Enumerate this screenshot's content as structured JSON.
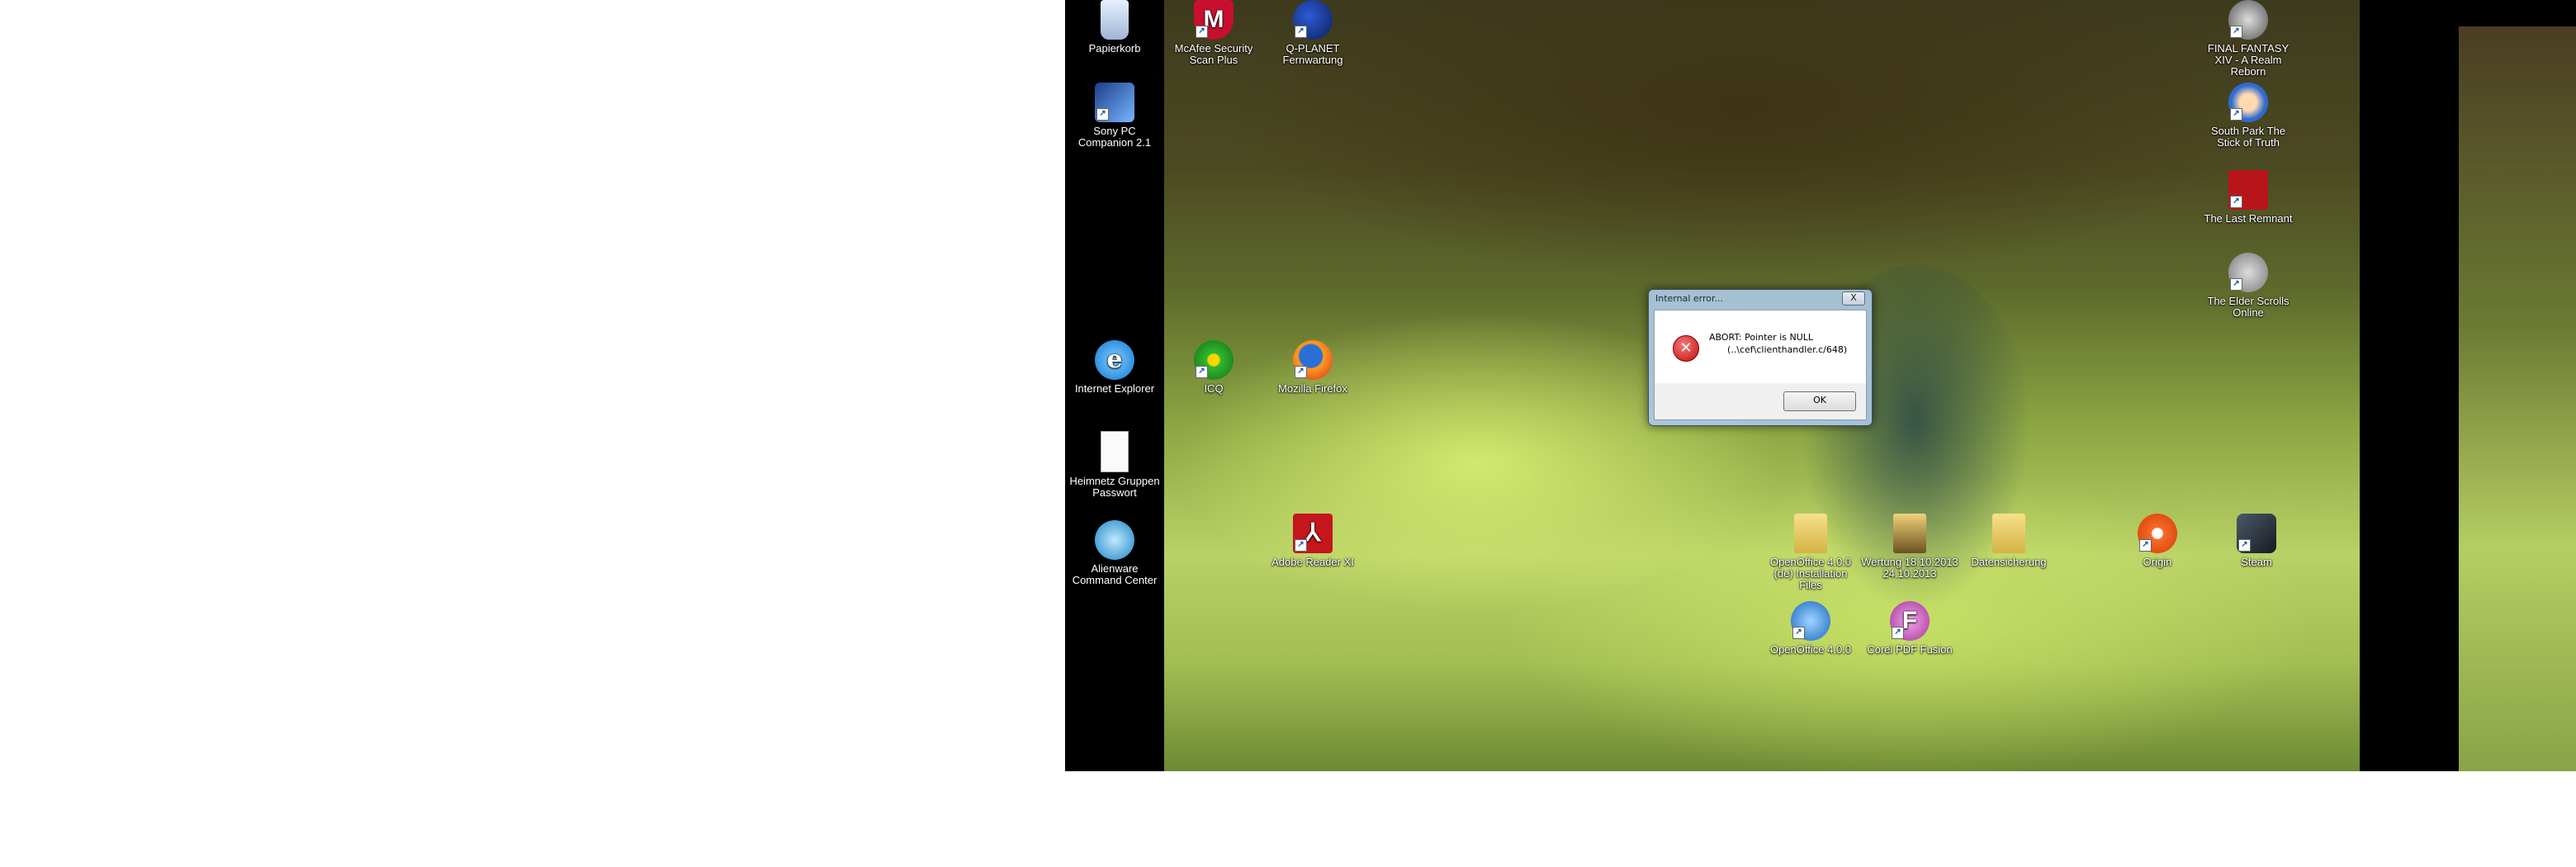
{
  "desktop": {
    "icons": [
      {
        "label": "Papierkorb",
        "icon": "recycle-bin-icon",
        "shortcut": false
      },
      {
        "label": "McAfee Security Scan Plus",
        "icon": "mcafee-icon",
        "shortcut": true
      },
      {
        "label": "Q-PLANET Fernwartung",
        "icon": "qplanet-icon",
        "shortcut": true
      },
      {
        "label": "Sony PC Companion 2.1",
        "icon": "sony-pc-companion-icon",
        "shortcut": true
      },
      {
        "label": "Internet Explorer",
        "icon": "internet-explorer-icon",
        "shortcut": false
      },
      {
        "label": "ICQ",
        "icon": "icq-icon",
        "shortcut": true
      },
      {
        "label": "Mozilla Firefox",
        "icon": "firefox-icon",
        "shortcut": true
      },
      {
        "label": "Heimnetz Gruppen Passwort",
        "icon": "text-document-icon",
        "shortcut": false
      },
      {
        "label": "Alienware Command Center",
        "icon": "alienware-icon",
        "shortcut": false
      },
      {
        "label": "Adobe Reader XI",
        "icon": "adobe-reader-icon",
        "shortcut": true
      },
      {
        "label": "OpenOffice 4.0.0 (de) Installation Files",
        "icon": "folder-icon",
        "shortcut": false
      },
      {
        "label": "Wertung 18.10.2013 24.10.2013",
        "icon": "folder-icon",
        "shortcut": false
      },
      {
        "label": "Datensicherung",
        "icon": "folder-icon",
        "shortcut": false
      },
      {
        "label": "Origin",
        "icon": "origin-icon",
        "shortcut": true
      },
      {
        "label": "Steam",
        "icon": "steam-icon",
        "shortcut": true
      },
      {
        "label": "OpenOffice 4.0.0",
        "icon": "openoffice-icon",
        "shortcut": true
      },
      {
        "label": "Corel PDF Fusion",
        "icon": "corel-pdf-fusion-icon",
        "shortcut": true
      },
      {
        "label": "FINAL FANTASY XIV - A Realm Reborn",
        "icon": "final-fantasy-xiv-icon",
        "shortcut": true
      },
      {
        "label": "South Park The Stick of Truth",
        "icon": "south-park-icon",
        "shortcut": true
      },
      {
        "label": "The Last Remnant",
        "icon": "last-remnant-icon",
        "shortcut": true
      },
      {
        "label": "The Elder Scrolls Online",
        "icon": "elder-scrolls-online-icon",
        "shortcut": true
      }
    ]
  },
  "dialog": {
    "title": "Internal error...",
    "close_label": "X",
    "message_line1": "ABORT: Pointer is NULL",
    "message_line2": "(..\\cef\\clienthandler.c/648)",
    "ok_label": "OK",
    "icon": "error-icon"
  },
  "colors": {
    "desktop_bg": "#ffffff",
    "monitor_bg": "#000000",
    "dialog_frame": "#aac8e1"
  }
}
